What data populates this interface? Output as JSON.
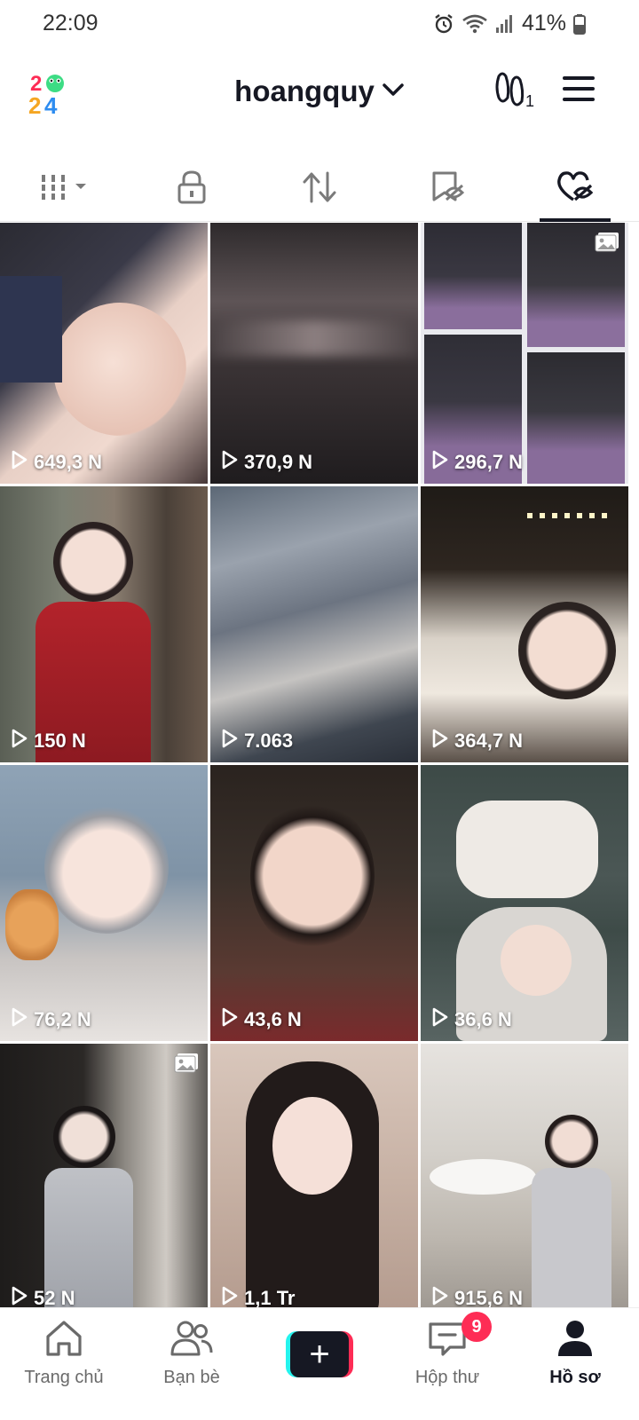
{
  "status_bar": {
    "time": "22:09",
    "battery": "41%"
  },
  "header": {
    "username": "hoangquy",
    "logo_text": "2024",
    "logo_alt": "logo-2024-icon"
  },
  "tabs": [
    {
      "name": "videos-tab",
      "icon": "grid-dropdown-icon",
      "active": false
    },
    {
      "name": "private-tab",
      "icon": "lock-icon",
      "active": false
    },
    {
      "name": "reposts-tab",
      "icon": "repost-icon",
      "active": false
    },
    {
      "name": "favorites-tab",
      "icon": "bookmark-hidden-icon",
      "active": false
    },
    {
      "name": "liked-tab",
      "icon": "heart-hidden-icon",
      "active": true
    }
  ],
  "videos": [
    {
      "views": "649,3 N",
      "photo": false
    },
    {
      "views": "370,9 N",
      "photo": false
    },
    {
      "views": "296,7 N",
      "photo": true
    },
    {
      "views": "150 N",
      "photo": false
    },
    {
      "views": "7.063",
      "photo": false
    },
    {
      "views": "364,7 N",
      "photo": false
    },
    {
      "views": "76,2 N",
      "photo": false
    },
    {
      "views": "43,6 N",
      "photo": false
    },
    {
      "views": "36,6 N",
      "photo": false
    },
    {
      "views": "52 N",
      "photo": true
    },
    {
      "views": "1,1 Tr",
      "photo": false
    },
    {
      "views": "915,6 N",
      "photo": false
    }
  ],
  "bottom_nav": {
    "home": "Trang chủ",
    "friends": "Bạn bè",
    "inbox": "Hộp thư",
    "inbox_badge": "9",
    "profile": "Hồ sơ"
  },
  "colors": {
    "accent_red": "#fe2c55",
    "accent_cyan": "#25f4ee",
    "text_dark": "#161823"
  }
}
